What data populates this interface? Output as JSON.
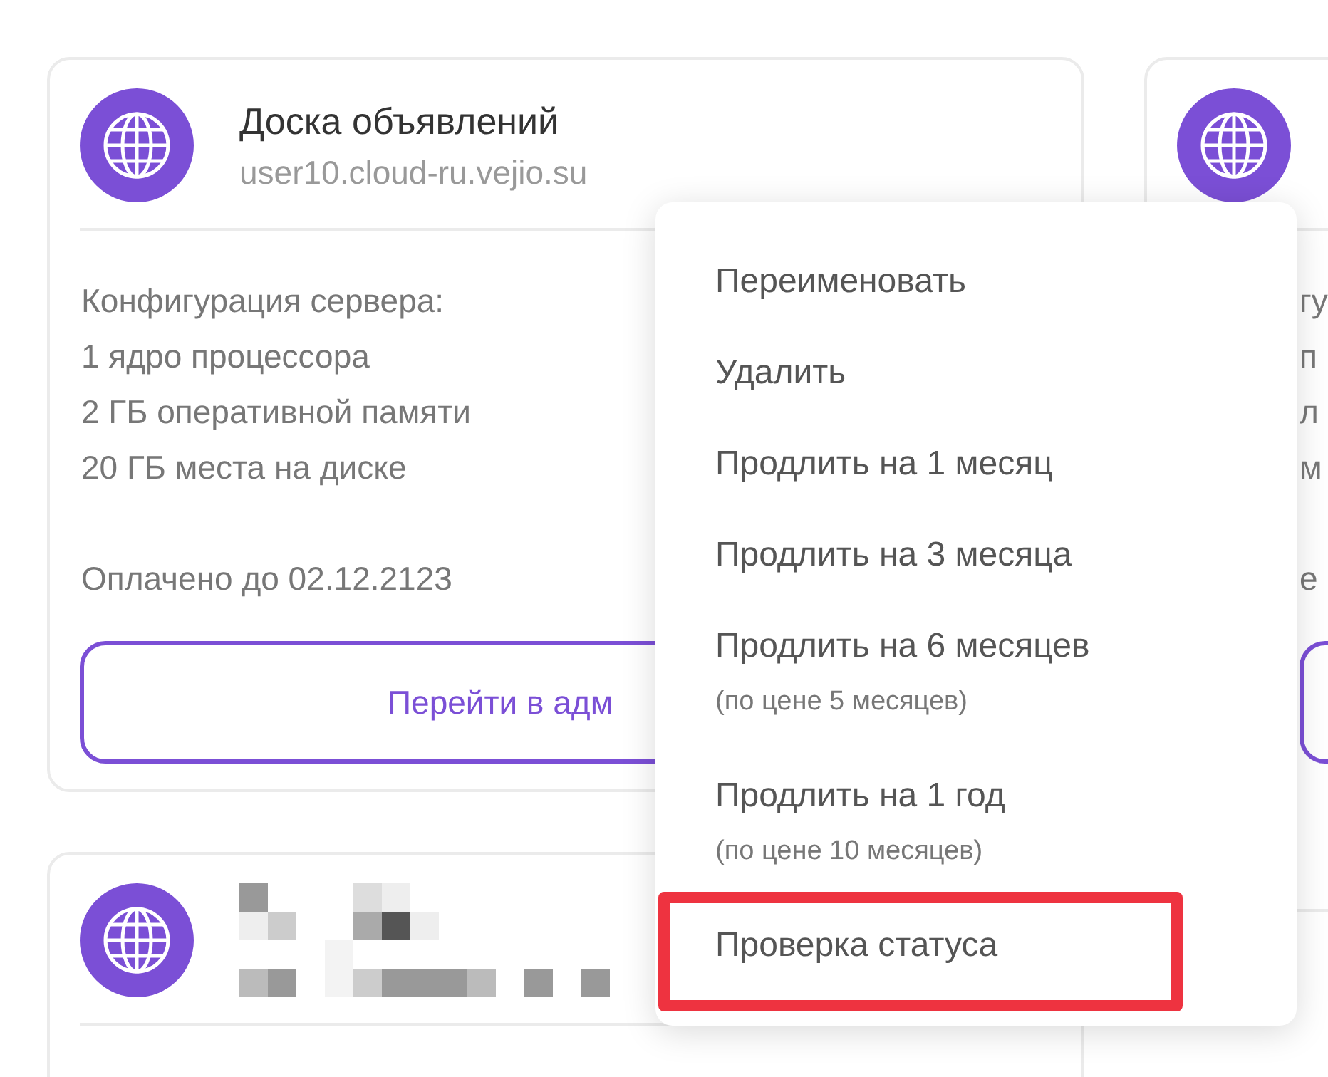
{
  "main_card": {
    "title": "Доска объявлений",
    "url": "user10.cloud-ru.vejio.su",
    "config_heading": "Конфигурация сервера:",
    "config": [
      "1 ядро процессора",
      "2 ГБ оперативной памяти",
      "20 ГБ места на диске"
    ],
    "paid_until": "Оплачено до 02.12.2123",
    "button": "Перейти в адм"
  },
  "right_card": {
    "fragments": [
      "гу",
      "п",
      "л",
      "м",
      "е"
    ]
  },
  "menu": {
    "items": [
      {
        "label": "Переименовать",
        "highlighted": false
      },
      {
        "label": "Удалить",
        "highlighted": false
      },
      {
        "label": "Продлить на 1 месяц",
        "highlighted": false
      },
      {
        "label": "Продлить на 3 месяца",
        "highlighted": false
      },
      {
        "label": "Продлить на 6 месяцев",
        "note": "(по цене 5 месяцев)",
        "highlighted": false
      },
      {
        "label": "Продлить на 1 год",
        "note": "(по цене 10 месяцев)",
        "highlighted": false
      },
      {
        "label": "Проверка статуса",
        "highlighted": true
      }
    ]
  }
}
